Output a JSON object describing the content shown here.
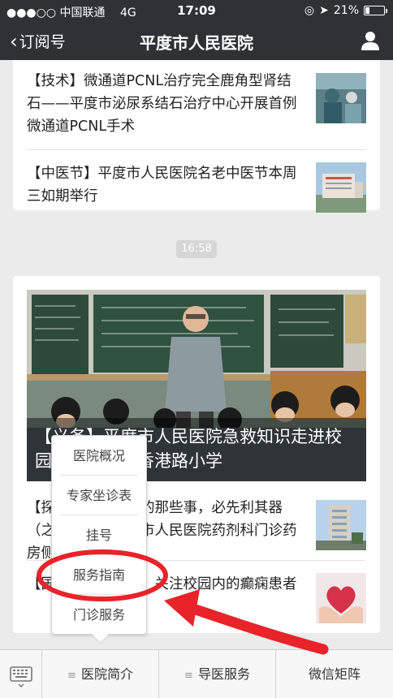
{
  "status": {
    "signal": "●●●○○",
    "carrier": "中国联通",
    "network": "4G",
    "time": "17:09",
    "battery": "21%",
    "battery_level": 0.21
  },
  "nav": {
    "back_label": "订阅号",
    "title": "平度市人民医院"
  },
  "top_card": {
    "items": [
      {
        "title": "【技术】微通道PCNL治疗完全鹿角型肾结石——平度市泌尿系结石治疗中心开展首例微通道PCNL手术",
        "thumb_icon": "surgery-photo"
      },
      {
        "title": "【中医节】平度市人民医院名老中医节本周三如期举行",
        "thumb_icon": "hospital-building-photo"
      }
    ]
  },
  "time_badge": "16:58",
  "main_card": {
    "hero_caption": "【义务】平度市人民医院急救知识走进校园——平度市香港路小学",
    "items": [
      {
        "title": "【探】医院药剂科的那些事，必先利其器（之三）——平度市人民医院药剂科门诊药房侧记",
        "thumb_icon": "hospital-building-photo"
      },
      {
        "title": "【国际癫痫关爱日】关注校园内的癫痫患者",
        "thumb_icon": "heart-hands-photo"
      }
    ]
  },
  "popup_menu": {
    "items": [
      "医院概况",
      "专家坐诊表",
      "挂号",
      "服务指南",
      "门诊服务"
    ]
  },
  "bottom_menu": {
    "tabs": [
      "医院简介",
      "导医服务",
      "微信矩阵"
    ],
    "hamburger": "≡"
  },
  "colors": {
    "navbar": "#2f3135",
    "annotation_red": "#e8232a"
  }
}
